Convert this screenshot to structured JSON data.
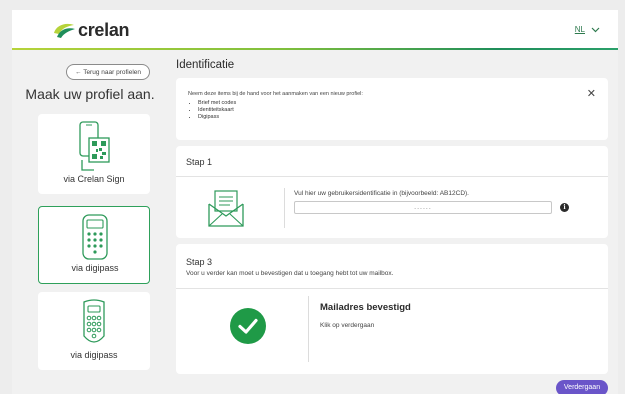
{
  "header": {
    "logo_text": "crelan",
    "language": "NL",
    "brand_colors": [
      "#7fbf3c",
      "#1f8e5a"
    ]
  },
  "sidebar": {
    "back_label": "← Terug naar profielen",
    "title": "Maak uw profiel aan.",
    "cards": [
      {
        "label": "via Crelan Sign",
        "icon": "phone-qr-icon",
        "selected": false
      },
      {
        "label": "via digipass",
        "icon": "digipass-icon",
        "selected": true
      },
      {
        "label": "via digipass",
        "icon": "digipass-round-icon",
        "selected": false
      }
    ]
  },
  "main": {
    "title": "Identificatie",
    "info": {
      "intro": "Neem deze items bij de hand voor het aanmaken van een nieuw profiel:",
      "items": [
        "Brief met codes",
        "Identiteitskaart",
        "Digipass"
      ]
    },
    "step1": {
      "heading": "Stap 1",
      "label": "Vul hier uw gebruikersidentificatie in (bijvoorbeeld: AB12CD).",
      "input_value": "......"
    },
    "step3": {
      "heading": "Stap 3",
      "description": "Voor u verder kan moet u bevestigen dat u toegang hebt tot uw mailbox.",
      "status_title": "Mailadres bevestigd",
      "status_sub": "Klik op verdergaan"
    },
    "next_label": "Verdergaan",
    "accent_color": "#6a55c9",
    "success_color": "#1f9a47"
  }
}
